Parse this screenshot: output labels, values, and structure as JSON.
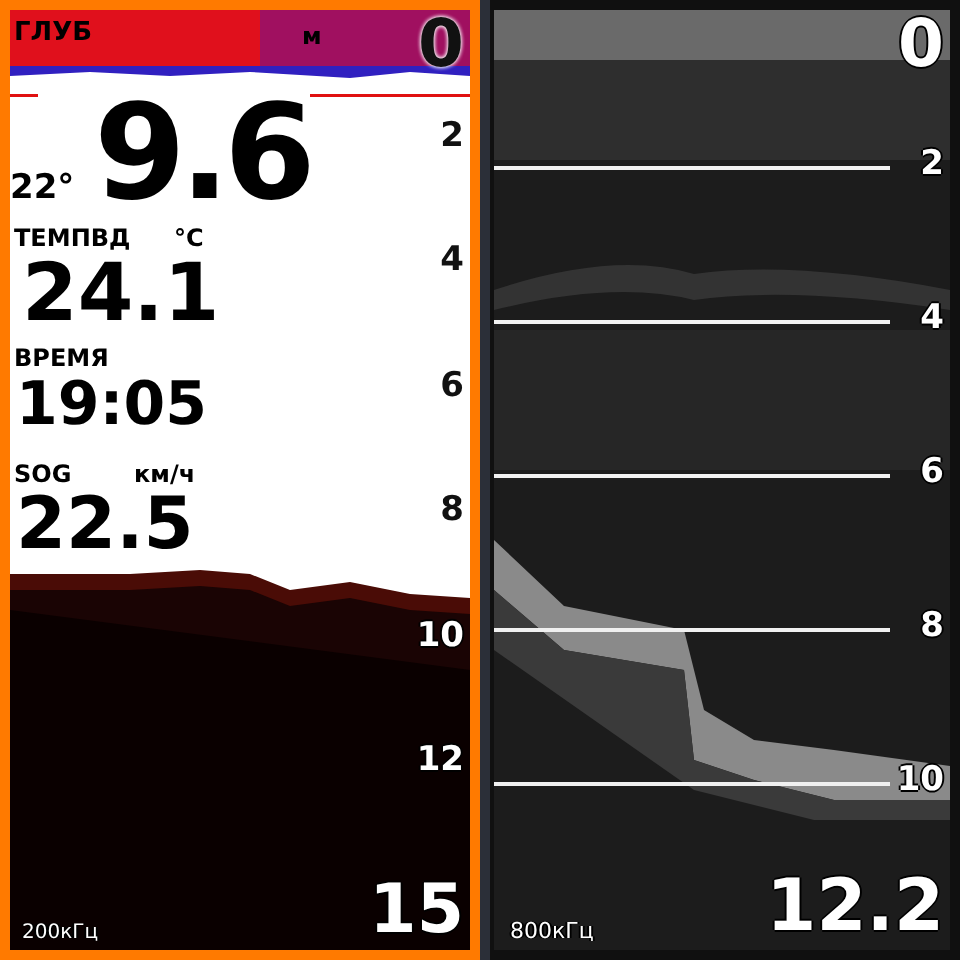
{
  "panes": [
    {
      "kind": "color",
      "selected": true,
      "frequency": "200кГц",
      "scale": [
        {
          "label": "0",
          "inverse": false
        },
        {
          "label": "2",
          "inverse": false
        },
        {
          "label": "4",
          "inverse": false
        },
        {
          "label": "6",
          "inverse": false
        },
        {
          "label": "8",
          "inverse": false
        },
        {
          "label": "10",
          "inverse": true
        },
        {
          "label": "12",
          "inverse": true
        }
      ],
      "range": "15",
      "readouts": [
        {
          "kind": "depth",
          "label": "ГЛУБ",
          "unit": "м",
          "value": "9.6",
          "extra": "22°"
        },
        {
          "kind": "temperature",
          "label": "ТЕМПВД",
          "unit": "°C",
          "value": "24.1"
        },
        {
          "kind": "time",
          "label": "ВРЕМЯ",
          "value": "19:05"
        },
        {
          "kind": "speed",
          "label": "SOG",
          "unit": "км/ч",
          "value": "22.5"
        }
      ]
    },
    {
      "kind": "gray",
      "selected": false,
      "frequency": "800кГц",
      "scale": [
        {
          "label": "0",
          "inverse": true
        },
        {
          "label": "2",
          "inverse": true
        },
        {
          "label": "4",
          "inverse": true
        },
        {
          "label": "6",
          "inverse": true
        },
        {
          "label": "8",
          "inverse": true
        },
        {
          "label": "10",
          "inverse": true
        }
      ],
      "range": "12.2"
    }
  ]
}
